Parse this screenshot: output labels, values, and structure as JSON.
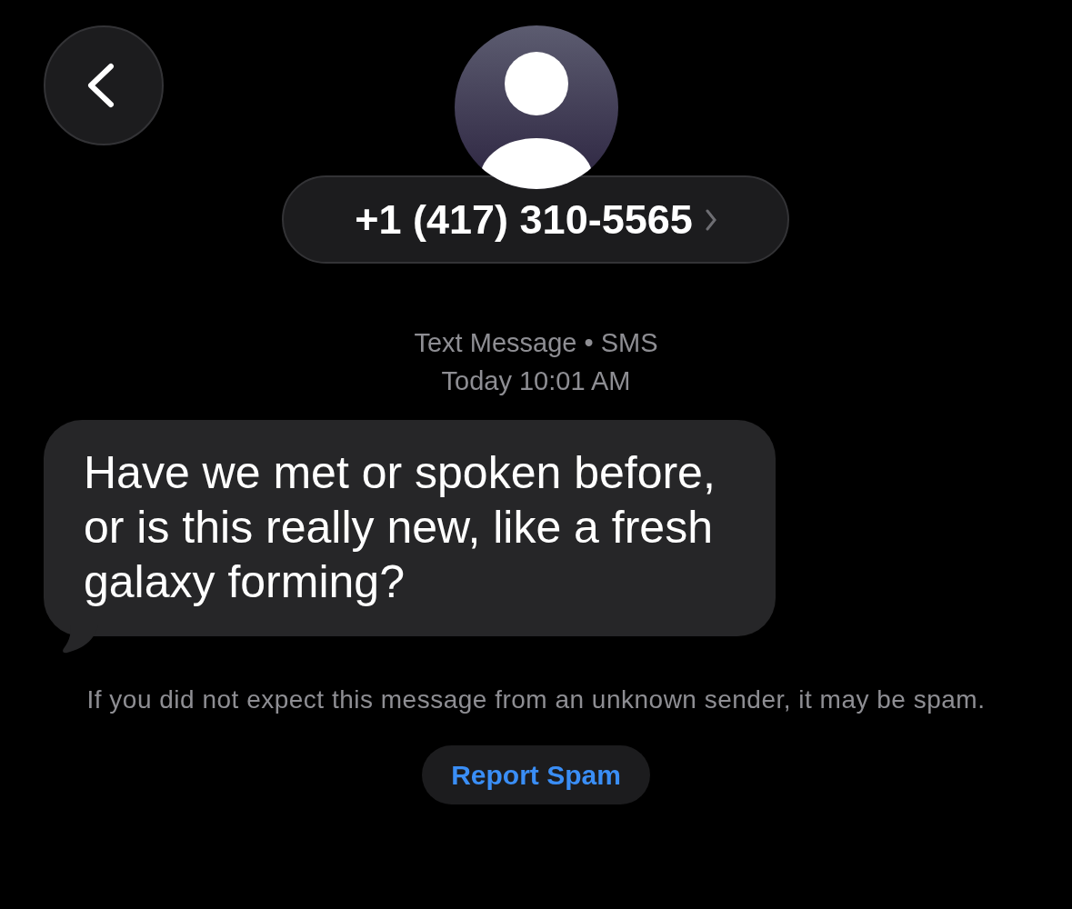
{
  "contact": {
    "phone": "+1 (417) 310-5565"
  },
  "conversation_info": {
    "service": "Text Message • SMS",
    "timestamp": "Today 10:01 AM"
  },
  "messages": [
    {
      "text": "Have we met or spoken before, or is this really new, like a fresh galaxy forming?"
    }
  ],
  "spam_notice": "If you did not expect this message from an unknown sender, it may be spam.",
  "report_button": "Report Spam"
}
